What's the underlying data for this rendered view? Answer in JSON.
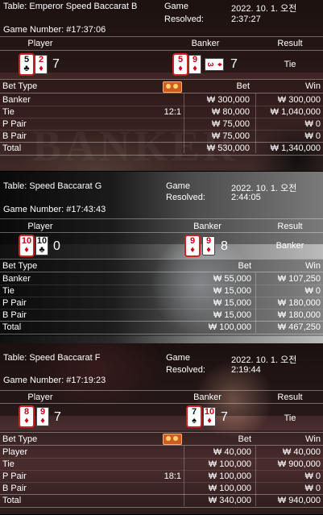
{
  "labels": {
    "game": "Game",
    "resolved": "Resolved:",
    "player": "Player",
    "banker": "Banker",
    "result": "Result",
    "bet_type": "Bet Type",
    "bet": "Bet",
    "win": "Win"
  },
  "icons": {
    "card_suits": [
      "spade-icon",
      "diamond-icon",
      "club-icon",
      "heart-icon"
    ],
    "bonus_chip": "chip-icon"
  },
  "colors": {
    "red_suit": "#d0021b",
    "black_suit": "#111111",
    "chip": "#cf5a22"
  },
  "rounds": [
    {
      "table": "Table: Emperor Speed Baccarat B",
      "game_number": "Game Number: #17:37:06",
      "date": "2022. 10. 1. 오전",
      "resolved_time": "2:37:27",
      "player_cards": [
        {
          "v": "5",
          "s": "♣",
          "c": "black"
        },
        {
          "v": "2",
          "s": "♦",
          "c": "red"
        }
      ],
      "player_score": "7",
      "banker_cards": [
        {
          "v": "5",
          "s": "♦",
          "c": "red"
        },
        {
          "v": "9",
          "s": "♦",
          "c": "red"
        },
        {
          "v": "3",
          "s": "♦",
          "c": "red",
          "side": true
        }
      ],
      "banker_score": "7",
      "result": "Tie",
      "rows": [
        {
          "type": "Banker",
          "odds": "",
          "bet": "₩ 300,000",
          "win": "₩ 300,000"
        },
        {
          "type": "Tie",
          "odds": "12:1",
          "bet": "₩ 80,000",
          "win": "₩ 1,040,000"
        },
        {
          "type": "P Pair",
          "odds": "",
          "bet": "₩ 75,000",
          "win": "₩ 0"
        },
        {
          "type": "B Pair",
          "odds": "",
          "bet": "₩ 75,000",
          "win": "₩ 0"
        }
      ],
      "total": {
        "type": "Total",
        "bet": "₩ 530,000",
        "win": "₩ 1,340,000"
      }
    },
    {
      "table": "Table: Speed Baccarat G",
      "game_number": "Game Number: #17:43:43",
      "date": "2022. 10. 1. 오전",
      "resolved_time": "2:44:05",
      "player_cards": [
        {
          "v": "10",
          "s": "♦",
          "c": "red"
        },
        {
          "v": "10",
          "s": "♣",
          "c": "black"
        }
      ],
      "player_score": "0",
      "banker_cards": [
        {
          "v": "9",
          "s": "♦",
          "c": "red"
        },
        {
          "v": "9",
          "s": "♦",
          "c": "red"
        }
      ],
      "banker_score": "8",
      "result": "Banker",
      "rows": [
        {
          "type": "Banker",
          "odds": "",
          "bet": "₩ 55,000",
          "win": "₩ 107,250"
        },
        {
          "type": "Tie",
          "odds": "",
          "bet": "₩ 15,000",
          "win": "₩ 0"
        },
        {
          "type": "P Pair",
          "odds": "",
          "bet": "₩ 15,000",
          "win": "₩ 180,000"
        },
        {
          "type": "B Pair",
          "odds": "",
          "bet": "₩ 15,000",
          "win": "₩ 180,000"
        }
      ],
      "total": {
        "type": "Total",
        "bet": "₩ 100,000",
        "win": "₩ 467,250"
      }
    },
    {
      "table": "Table: Speed Baccarat F",
      "game_number": "Game Number: #17:19:23",
      "date": "2022. 10. 1. 오전",
      "resolved_time": "2:19:44",
      "player_cards": [
        {
          "v": "8",
          "s": "♦",
          "c": "red"
        },
        {
          "v": "9",
          "s": "♦",
          "c": "red"
        }
      ],
      "player_score": "7",
      "banker_cards": [
        {
          "v": "7",
          "s": "♠",
          "c": "black"
        },
        {
          "v": "10",
          "s": "♦",
          "c": "red"
        }
      ],
      "banker_score": "7",
      "result": "Tie",
      "rows": [
        {
          "type": "Player",
          "odds": "",
          "bet": "₩ 40,000",
          "win": "₩ 40,000"
        },
        {
          "type": "Tie",
          "odds": "",
          "bet": "₩ 100,000",
          "win": "₩ 900,000"
        },
        {
          "type": "P Pair",
          "odds": "18:1",
          "bet": "₩ 100,000",
          "win": "₩ 0"
        },
        {
          "type": "B Pair",
          "odds": "",
          "bet": "₩ 100,000",
          "win": "₩ 0"
        }
      ],
      "total": {
        "type": "Total",
        "bet": "₩ 340,000",
        "win": "₩ 940,000"
      }
    }
  ]
}
